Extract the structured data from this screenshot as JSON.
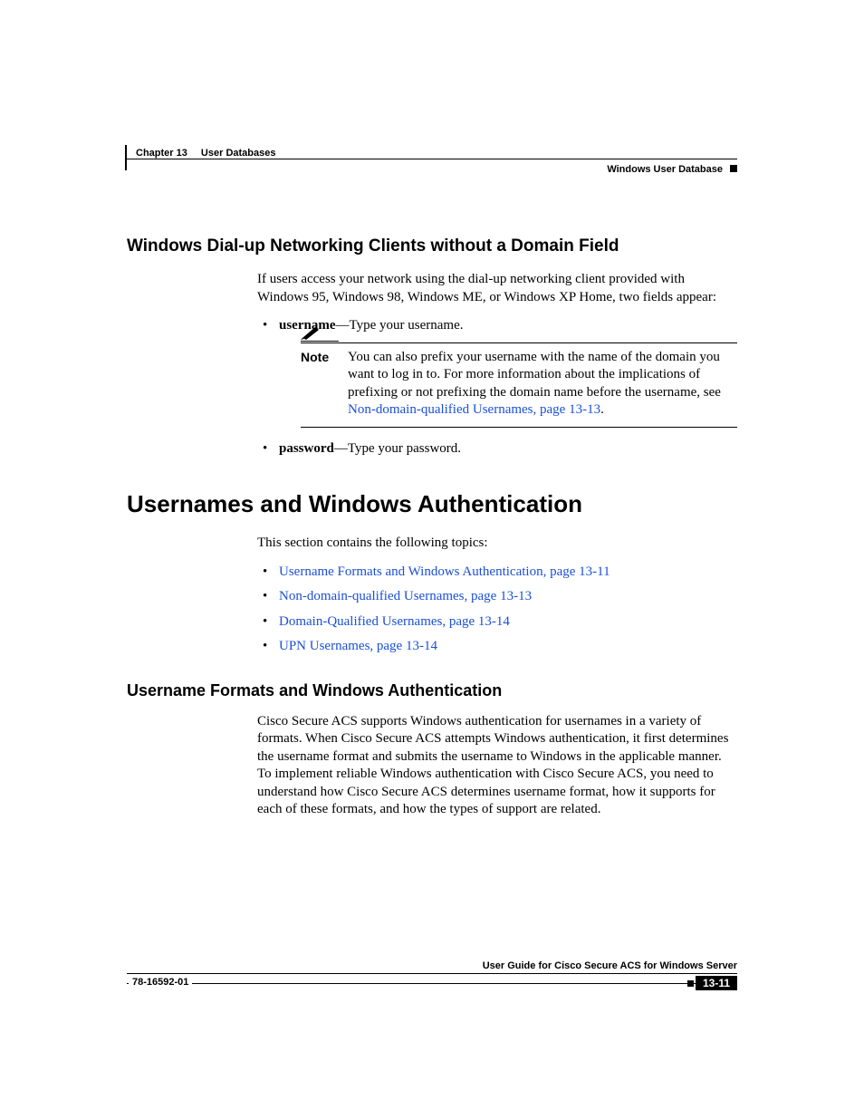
{
  "header": {
    "chapter_label": "Chapter 13",
    "chapter_title": "User Databases",
    "section_title": "Windows User Database"
  },
  "section1": {
    "heading": "Windows Dial-up Networking Clients without a Domain Field",
    "intro": "If users access your network using the dial-up networking client provided with Windows 95, Windows 98, Windows ME, or Windows XP Home, two fields appear:",
    "bullet1_term": "username",
    "bullet1_rest": "—Type your username.",
    "note_label": "Note",
    "note_text_pre": "You can also prefix your username with the name of the domain you want to log in to. For more information about the implications of prefixing or not prefixing the domain name before the username, see ",
    "note_link": "Non-domain-qualified Usernames, page 13-13",
    "note_text_post": ".",
    "bullet2_term": "password",
    "bullet2_rest": "—Type your password."
  },
  "section2": {
    "heading": "Usernames and Windows Authentication",
    "intro": "This section contains the following topics:",
    "links": [
      "Username Formats and Windows Authentication, page 13-11",
      "Non-domain-qualified Usernames, page 13-13",
      "Domain-Qualified Usernames, page 13-14",
      "UPN Usernames, page 13-14"
    ]
  },
  "section3": {
    "heading": "Username Formats and Windows Authentication",
    "body": "Cisco Secure ACS supports Windows authentication for usernames in a variety of formats. When Cisco Secure ACS attempts Windows authentication, it first determines the username format and submits the username to Windows in the applicable manner. To implement reliable Windows authentication with Cisco Secure ACS, you need to understand how Cisco Secure ACS determines username format, how it supports for each of these formats, and how the types of support are related."
  },
  "footer": {
    "guide_title": "User Guide for Cisco Secure ACS for Windows Server",
    "doc_number": "78-16592-01",
    "page_number": "13-11"
  }
}
